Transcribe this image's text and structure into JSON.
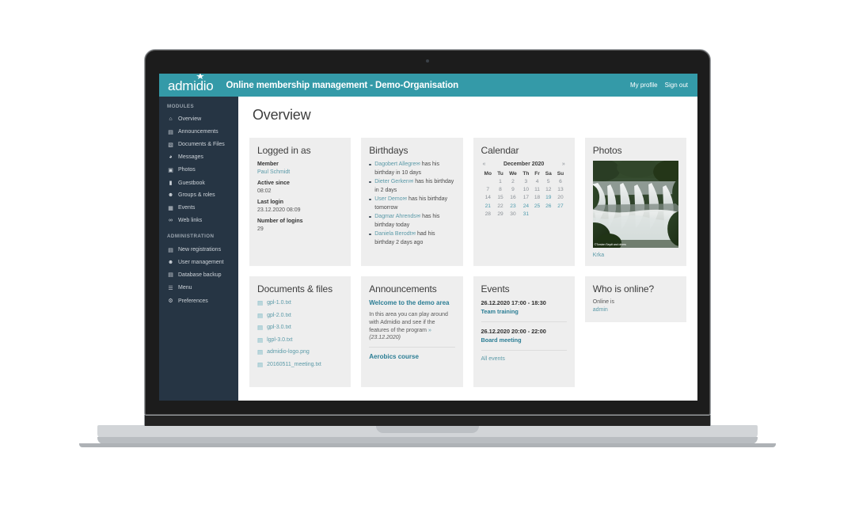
{
  "header": {
    "logo_text": "admidio",
    "title": "Online membership management - Demo-Organisation",
    "my_profile": "My profile",
    "sign_out": "Sign out"
  },
  "sidebar": {
    "section_modules": "MODULES",
    "section_administration": "ADMINISTRATION",
    "modules": [
      {
        "label": "Overview",
        "icon": "home-icon",
        "glyph": "⌂"
      },
      {
        "label": "Announcements",
        "icon": "newspaper-icon",
        "glyph": "▤"
      },
      {
        "label": "Documents & Files",
        "icon": "file-icon",
        "glyph": "▧"
      },
      {
        "label": "Messages",
        "icon": "comments-icon",
        "glyph": "◕"
      },
      {
        "label": "Photos",
        "icon": "image-icon",
        "glyph": "▣"
      },
      {
        "label": "Guestbook",
        "icon": "book-icon",
        "glyph": "▮"
      },
      {
        "label": "Groups & roles",
        "icon": "users-icon",
        "glyph": "☻"
      },
      {
        "label": "Events",
        "icon": "calendar-icon",
        "glyph": "▦"
      },
      {
        "label": "Web links",
        "icon": "link-icon",
        "glyph": "∞"
      }
    ],
    "administration": [
      {
        "label": "New registrations",
        "icon": "id-card-icon",
        "glyph": "▤"
      },
      {
        "label": "User management",
        "icon": "user-cog-icon",
        "glyph": "☻"
      },
      {
        "label": "Database backup",
        "icon": "database-icon",
        "glyph": "▤"
      },
      {
        "label": "Menu",
        "icon": "menu-icon",
        "glyph": "☰"
      },
      {
        "label": "Preferences",
        "icon": "gear-icon",
        "glyph": "⚙"
      }
    ]
  },
  "page": {
    "title": "Overview"
  },
  "logged_in": {
    "title": "Logged in as",
    "member_label": "Member",
    "member_name": "Paul Schmidt",
    "active_since_label": "Active since",
    "active_since_value": "08:02",
    "last_login_label": "Last login",
    "last_login_value": "23.12.2020 08:09",
    "number_of_logins_label": "Number of logins",
    "number_of_logins_value": "29"
  },
  "birthdays": {
    "title": "Birthdays",
    "items": [
      {
        "name": "Dagobert Allegre",
        "text": "has his birthday in 10 days"
      },
      {
        "name": "Dieter Gerken",
        "text": "has his birthday in 2 days"
      },
      {
        "name": "User Demo",
        "text": "has his birthday tomorrow"
      },
      {
        "name": "Dagmar Ahrends",
        "text": "has his birthday today"
      },
      {
        "name": "Daniela Berodt",
        "text": "had his birthday 2 days ago"
      }
    ]
  },
  "calendar": {
    "title": "Calendar",
    "prev": "«",
    "next": "»",
    "month_label": "December 2020",
    "weekdays": [
      "Mo",
      "Tu",
      "We",
      "Th",
      "Fr",
      "Sa",
      "Su"
    ],
    "weeks": [
      [
        "",
        "1",
        "2",
        "3",
        "4",
        "5",
        "6"
      ],
      [
        "7",
        "8",
        "9",
        "10",
        "11",
        "12",
        "13"
      ],
      [
        "14",
        "15",
        "16",
        "17",
        "18",
        "19",
        "20"
      ],
      [
        "21",
        "22",
        "23",
        "24",
        "25",
        "26",
        "27"
      ],
      [
        "28",
        "29",
        "30",
        "31",
        "",
        "",
        ""
      ]
    ],
    "highlighted": [
      "19",
      "21",
      "23",
      "24",
      "25",
      "26",
      "27",
      "31"
    ]
  },
  "photos": {
    "title": "Photos",
    "credit": "©Torsten Seydt and others",
    "caption": "Krka"
  },
  "documents": {
    "title": "Documents & files",
    "files": [
      {
        "name": "gpl-1.0.txt",
        "icon": "text-file-icon"
      },
      {
        "name": "gpl-2.0.txt",
        "icon": "text-file-icon"
      },
      {
        "name": "gpl-3.0.txt",
        "icon": "text-file-icon"
      },
      {
        "name": "lgpl-3.0.txt",
        "icon": "text-file-icon"
      },
      {
        "name": "admidio-logo.png",
        "icon": "image-file-icon"
      },
      {
        "name": "20160511_meeting.txt",
        "icon": "text-file-icon"
      }
    ]
  },
  "announcements": {
    "title": "Announcements",
    "items": [
      {
        "headline": "Welcome to the demo area",
        "body": "In this area you can play around with Admidio and see if the features of the program",
        "more": "»",
        "date": "(23.12.2020)"
      },
      {
        "headline": "Aerobics course",
        "body": "",
        "more": "",
        "date": ""
      }
    ]
  },
  "events": {
    "title": "Events",
    "items": [
      {
        "when": "26.12.2020  17:00 - 18:30",
        "name": "Team training"
      },
      {
        "when": "26.12.2020  20:00 - 22:00",
        "name": "Board meeting"
      }
    ],
    "all_events": "All events"
  },
  "who_is_online": {
    "title": "Who is online?",
    "label": "Online is",
    "user": "admin"
  },
  "colors": {
    "accent_teal": "#349aa8",
    "sidebar_dark": "#263544",
    "card_bg": "#eeeeee",
    "link": "#5b9aa8"
  }
}
